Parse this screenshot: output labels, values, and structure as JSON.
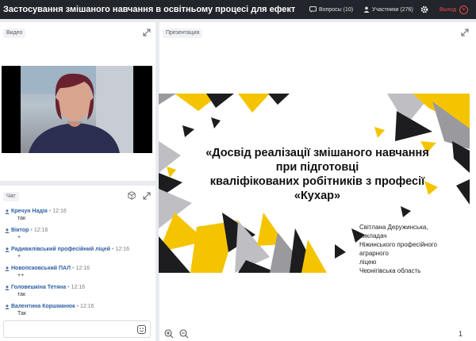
{
  "header": {
    "title": "Застосування змішаного навчання в освітньому процесі для ефективної",
    "questions_label": "Вопросы (10)",
    "participants_label": "Участники (276)",
    "exit_label": "Выход",
    "settings_icon": "gear-icon"
  },
  "video": {
    "label": "Видео"
  },
  "presentation": {
    "label": "Презентация",
    "slide_title_line1": "«Досвід реалізації змішаного навчання",
    "slide_title_line2": "при підготовці",
    "slide_title_line3": "кваліфікованих робітників з професії",
    "slide_title_line4": "«Кухар»",
    "author_line1": "Світлана Деружинська,",
    "author_line2": "викладач",
    "author_line3": "Ніжинського професійного аграрного",
    "author_line4": "ліцею",
    "author_line5": "Чернігівська область",
    "page_number": "1"
  },
  "chat": {
    "label": "Чат",
    "messages": [
      {
        "name": "Кречун Надія",
        "time": "12:16",
        "text": "так"
      },
      {
        "name": "Віктор",
        "time": "12:16",
        "text": "+"
      },
      {
        "name": "Радивилівський професійний ліцей",
        "time": "12:16",
        "text": "+"
      },
      {
        "name": "Новопсковський ПАЛ",
        "time": "12:16",
        "text": "++"
      },
      {
        "name": "Головешкіна Тетяна",
        "time": "12:16",
        "text": "так"
      },
      {
        "name": "Валентина Коршманюк",
        "time": "12:16",
        "text": "Так"
      }
    ]
  },
  "colors": {
    "topbar": "#22252b",
    "accent_yellow": "#f5c400",
    "exit_red": "#f0494b",
    "chat_name": "#2d5fa3"
  }
}
